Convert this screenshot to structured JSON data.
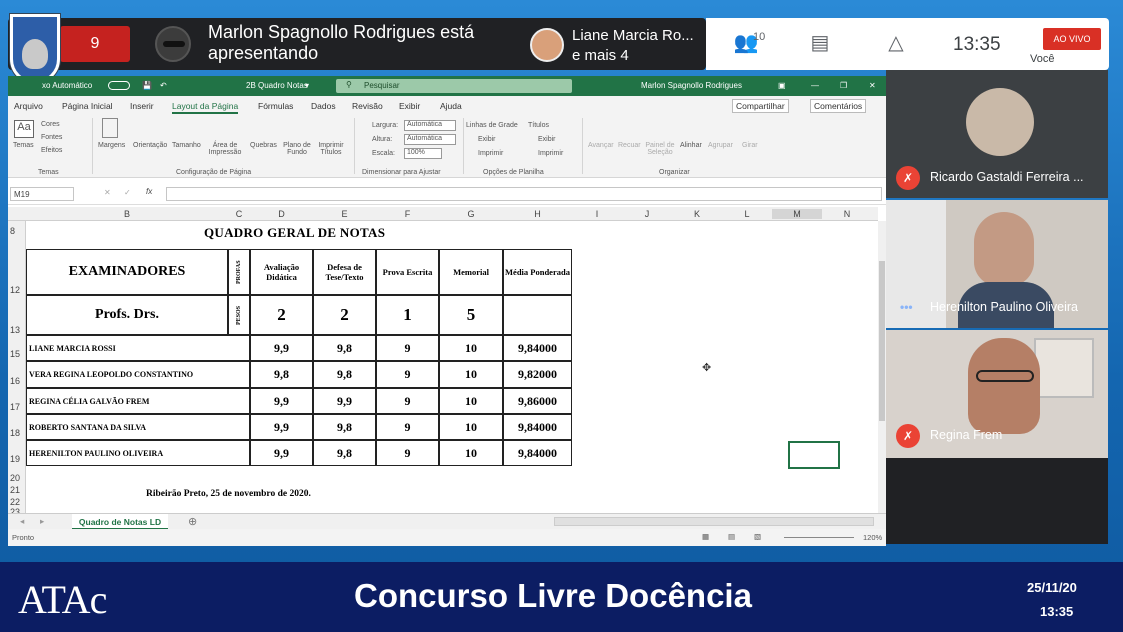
{
  "meeting": {
    "tile_count": "9",
    "presenter_text": "Marlon Spagnollo Rodrigues está apresentando",
    "other_text": "Liane Marcia Ro... e mais 4",
    "people_count": "10",
    "clock": "13:35",
    "live_label": "AO VIVO",
    "you_label": "Você"
  },
  "excel": {
    "autosave_label": "xo Automático",
    "filename": "2B Quadro Notas",
    "search_placeholder": "Pesquisar",
    "user_name": "Marlon Spagnollo Rodrigues",
    "menus": [
      "Arquivo",
      "Página Inicial",
      "Inserir",
      "Layout da Página",
      "Fórmulas",
      "Dados",
      "Revisão",
      "Exibir",
      "Ajuda"
    ],
    "share_label": "Compartilhar",
    "comments_label": "Comentários",
    "ribbon": {
      "temas": "Temas",
      "cores": "Cores",
      "fontes": "Fontes",
      "efeitos": "Efeitos",
      "margens": "Margens",
      "orientacao": "Orientação",
      "tamanho": "Tamanho",
      "area_impressao": "Área de Impressão",
      "quebras": "Quebras",
      "plano_fundo": "Plano de Fundo",
      "imprimir_titulos": "Imprimir Títulos",
      "largura": "Largura:",
      "altura": "Altura:",
      "escala": "Escala:",
      "automatica": "Automática",
      "escala_val": "100%",
      "linhas_grade": "Linhas de Grade",
      "titulos": "Títulos",
      "exibir": "Exibir",
      "imprimir": "Imprimir",
      "avancar": "Avançar",
      "recuar": "Recuar",
      "painel_selecao": "Painel de Seleção",
      "alinhar": "Alinhar",
      "agrupar": "Agrupar",
      "girar": "Girar",
      "grp_temas": "Temas",
      "grp_config": "Configuração de Página",
      "grp_dimensionar": "Dimensionar para Ajustar",
      "grp_opcoes": "Opções de Planilha",
      "grp_organizar": "Organizar"
    },
    "name_box": "M19",
    "columns": [
      "B",
      "C",
      "D",
      "E",
      "F",
      "G",
      "H",
      "I",
      "J",
      "K",
      "L",
      "M",
      "N"
    ],
    "rows": [
      "8",
      "12",
      "13",
      "15",
      "16",
      "17",
      "18",
      "19",
      "20",
      "21",
      "22",
      "23"
    ],
    "sheet": {
      "title": "QUADRO GERAL DE NOTAS",
      "examiners_header": "EXAMINADORES",
      "profs_header": "Profs. Drs.",
      "notas_vertical": "PROFAS",
      "pesos_vertical": "PESOS",
      "headers": [
        "Avaliação Didática",
        "Defesa de Tese/Texto",
        "Prova Escrita",
        "Memorial",
        "Média Ponderada"
      ],
      "weights": [
        "2",
        "2",
        "1",
        "5"
      ],
      "examiners": [
        {
          "name": "LIANE MARCIA ROSSI",
          "scores": [
            "9,9",
            "9,8",
            "9",
            "10"
          ],
          "avg": "9,84000"
        },
        {
          "name": "VERA REGINA LEOPOLDO CONSTANTINO",
          "scores": [
            "9,8",
            "9,8",
            "9",
            "10"
          ],
          "avg": "9,82000"
        },
        {
          "name": "REGINA CÉLIA GALVÃO FREM",
          "scores": [
            "9,9",
            "9,9",
            "9",
            "10"
          ],
          "avg": "9,86000"
        },
        {
          "name": "ROBERTO SANTANA DA SILVA",
          "scores": [
            "9,9",
            "9,8",
            "9",
            "10"
          ],
          "avg": "9,84000"
        },
        {
          "name": "HERENILTON PAULINO OLIVEIRA",
          "scores": [
            "9,9",
            "9,8",
            "9",
            "10"
          ],
          "avg": "9,84000"
        }
      ],
      "footer_note": "Ribeirão Preto, 25 de novembro de 2020."
    },
    "sheet_tab": "Quadro de Notas LD",
    "status": "Pronto",
    "zoom": "120%"
  },
  "participants": [
    {
      "name": "Ricardo Gastaldi Ferreira ...",
      "muted": true
    },
    {
      "name": "Herenilton Paulino Oliveira",
      "muted": false
    },
    {
      "name": "Regina Frem",
      "muted": true
    }
  ],
  "banner": {
    "logo": "ATAc",
    "title": "Concurso Livre Docência",
    "date": "25/11/20",
    "time": "13:35"
  }
}
